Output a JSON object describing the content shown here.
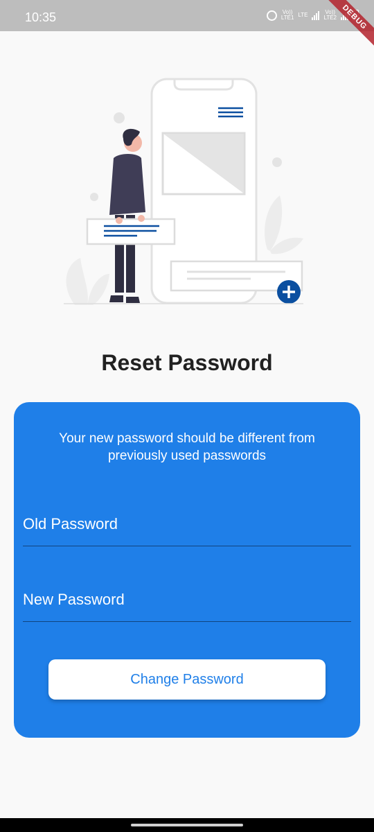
{
  "status_bar": {
    "time": "10:35",
    "sim1_label_top": "Vo))",
    "sim1_label_bottom": "LTE1",
    "lte_label": "LTE",
    "sim2_label_top": "Vo))",
    "sim2_label_bottom": "LTE2",
    "icons": [
      "alarm-icon",
      "signal-icon",
      "signal-icon",
      "battery-icon"
    ]
  },
  "debug_banner": "DEBUG",
  "page": {
    "title": "Reset Password"
  },
  "form": {
    "subtitle": "Your new password should be different from previously used passwords",
    "old_password_placeholder": "Old Password",
    "new_password_placeholder": "New Password",
    "submit_label": "Change Password"
  },
  "colors": {
    "primary": "#1f7fe8",
    "accent_dark": "#0b4fa0",
    "background": "#f9f9f9"
  }
}
